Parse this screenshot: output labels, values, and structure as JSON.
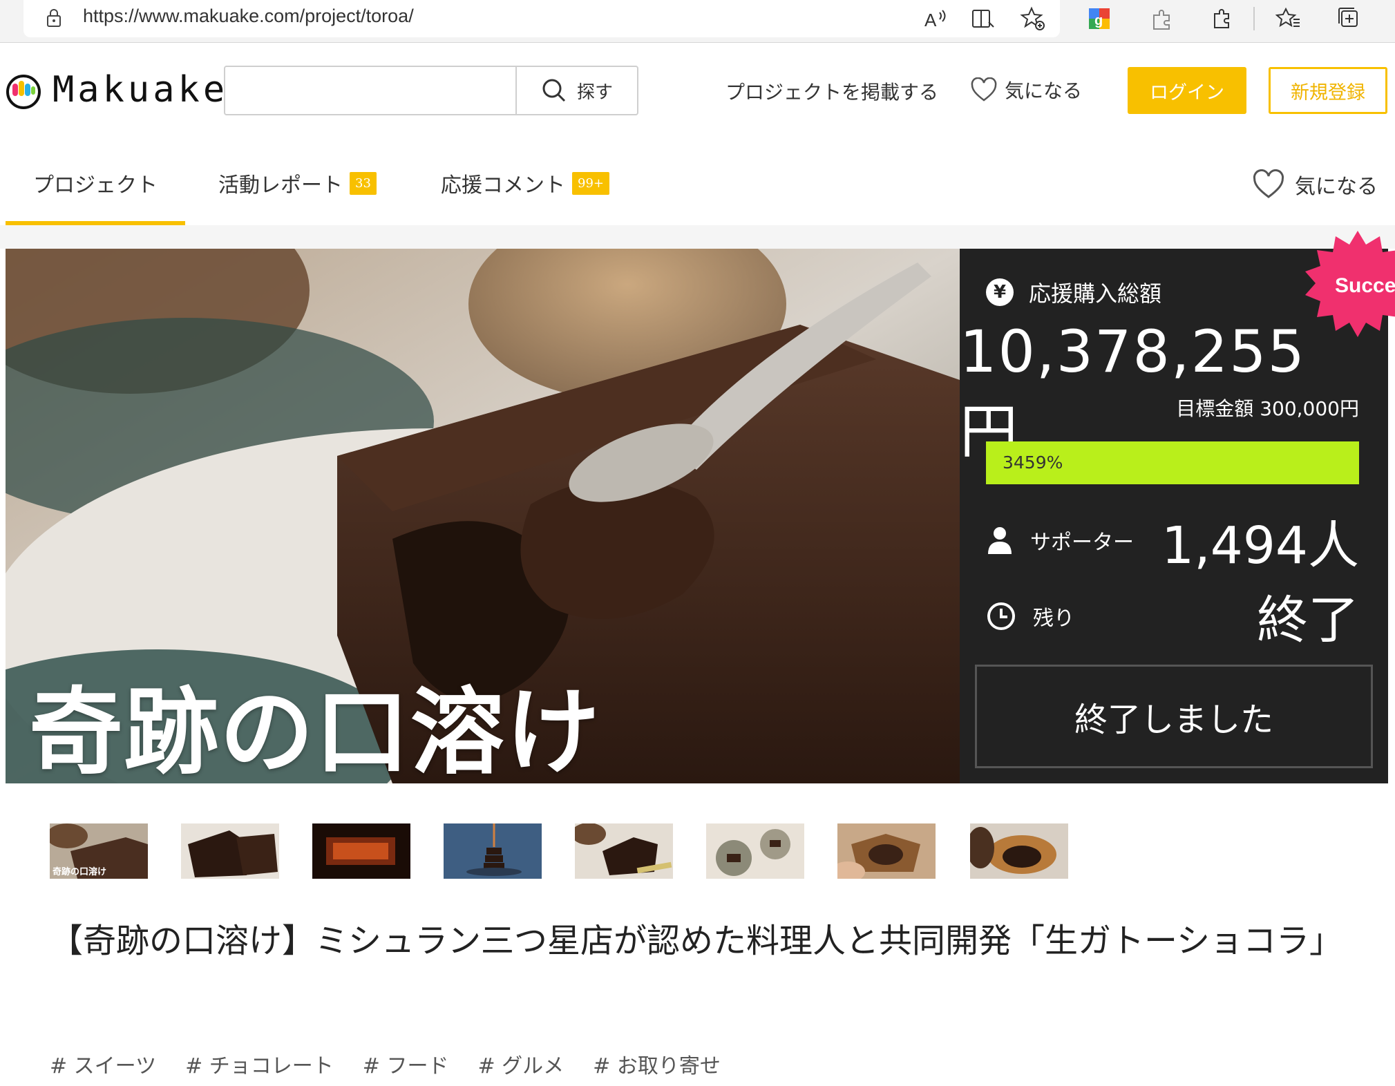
{
  "browser": {
    "url": "https://www.makuake.com/project/toroa/"
  },
  "header": {
    "logo_text": "Makuake",
    "search_placeholder": "",
    "search_button": "探す",
    "post_project": "プロジェクトを掲載する",
    "favorite": "気になる",
    "login": "ログイン",
    "signup": "新規登録"
  },
  "tabs": {
    "items": [
      {
        "label": "プロジェクト",
        "badge": ""
      },
      {
        "label": "活動レポート",
        "badge": "33"
      },
      {
        "label": "応援コメント",
        "badge": "99+"
      }
    ],
    "favorite": "気になる"
  },
  "hero": {
    "caption": "奇跡の口溶け"
  },
  "stats": {
    "total_label": "応援購入総額",
    "total_amount": "10,378,255円",
    "goal": "目標金額 300,000円",
    "progress_percent": 3459,
    "progress_label": "3459%",
    "supporters_label": "サポーター",
    "supporters_value": "1,494人",
    "remaining_label": "残り",
    "remaining_value": "終了",
    "ended_button": "終了しました",
    "success_badge": "Success!"
  },
  "thumbnail_caption": "奇跡の口溶け",
  "project": {
    "title": "【奇跡の口溶け】ミシュラン三つ星店が認めた料理人と共同開発「生ガトーショコラ」",
    "tags": [
      "# スイーツ",
      "# チョコレート",
      "# フード",
      "# グルメ",
      "# お取り寄せ"
    ]
  },
  "colors": {
    "brand_yellow": "#f8c000",
    "panel_bg": "#222222",
    "progress_green": "#b9ef1b",
    "success_pink": "#f0306e"
  }
}
